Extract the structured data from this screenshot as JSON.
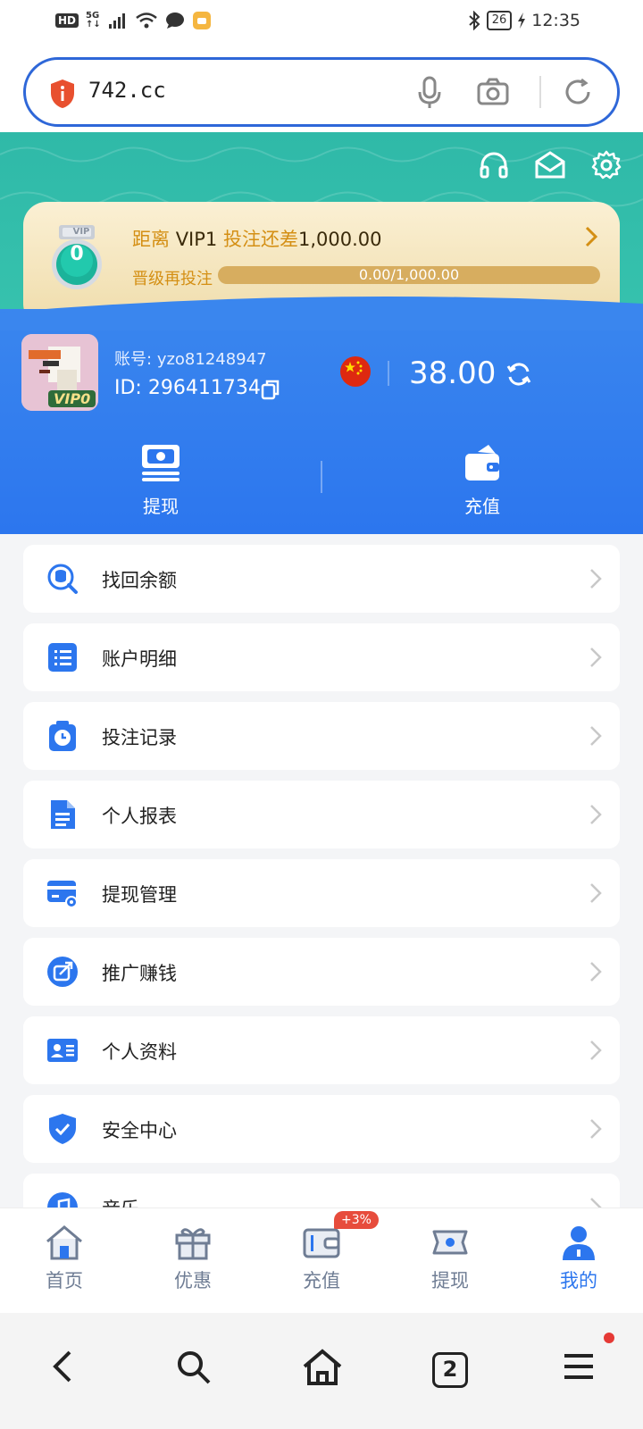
{
  "status_bar": {
    "left": "HD 5G",
    "time": "12:35",
    "battery": "26"
  },
  "address_bar": {
    "url": "742.cc"
  },
  "vip_card": {
    "line_prefix": "距离",
    "vip_level": "VIP1",
    "line_mid": "投注还差",
    "amount": "1,000.00",
    "line2_label": "晋级再投注",
    "progress_text": "0.00/1,000.00",
    "progress_fraction": 0,
    "medal_level": "0",
    "medal_tag": "VIP"
  },
  "profile": {
    "account_label": "账号:",
    "account": "yzo81248947",
    "id_label": "ID:",
    "id": "296411734",
    "vip_badge": "VIP0",
    "balance": "38.00"
  },
  "actions": {
    "withdraw": "提现",
    "deposit": "充值"
  },
  "menu": [
    {
      "label": "找回余额",
      "icon": "search-coins-icon"
    },
    {
      "label": "账户明细",
      "icon": "list-icon"
    },
    {
      "label": "投注记录",
      "icon": "clock-clipboard-icon"
    },
    {
      "label": "个人报表",
      "icon": "document-icon"
    },
    {
      "label": "提现管理",
      "icon": "card-settings-icon"
    },
    {
      "label": "推广赚钱",
      "icon": "share-icon"
    },
    {
      "label": "个人资料",
      "icon": "id-card-icon"
    },
    {
      "label": "安全中心",
      "icon": "shield-check-icon"
    },
    {
      "label": "音乐",
      "icon": "music-icon"
    }
  ],
  "tabs": [
    {
      "label": "首页",
      "icon": "home-icon"
    },
    {
      "label": "优惠",
      "icon": "gift-icon"
    },
    {
      "label": "充值",
      "icon": "wallet-icon"
    },
    {
      "label": "提现",
      "icon": "cash-icon"
    },
    {
      "label": "我的",
      "icon": "user-icon",
      "active": true
    }
  ],
  "tab_badge": "+3%",
  "browser_nav": {
    "tabs_count": "2"
  },
  "colors": {
    "primary": "#2c76ee",
    "teal": "#2fb9a8",
    "gold": "#d48f14"
  }
}
